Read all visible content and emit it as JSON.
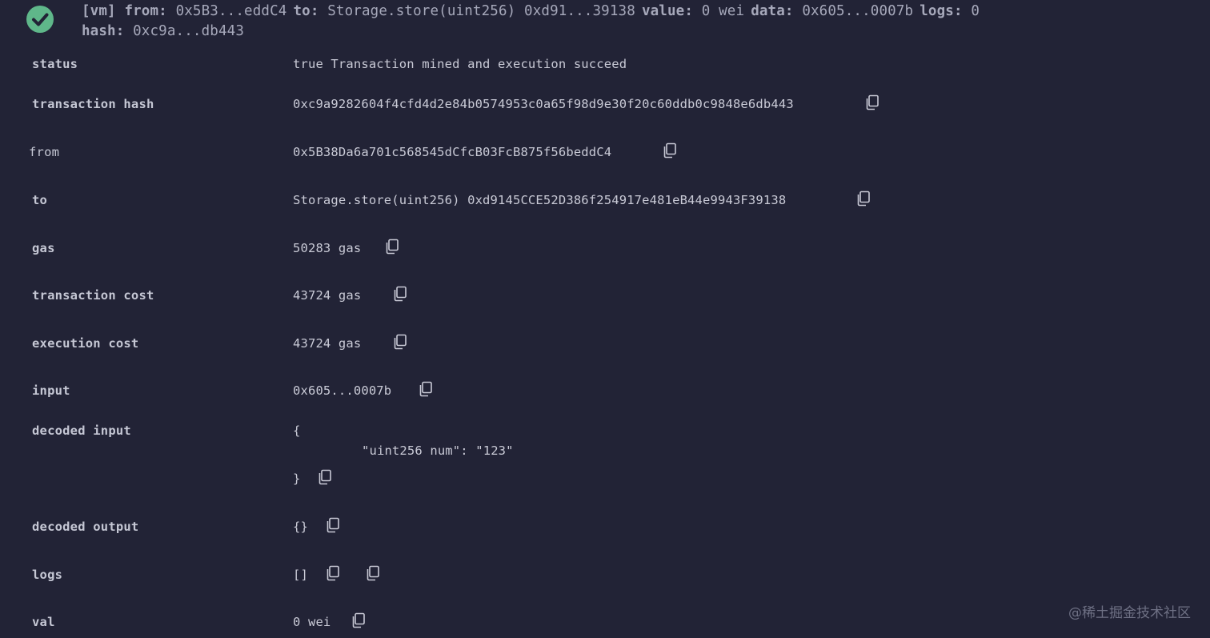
{
  "header": {
    "vm_tag": "[vm]",
    "from_label": "from:",
    "from_value": "0x5B3...eddC4",
    "to_label": "to:",
    "to_value": "Storage.store(uint256) 0xd91...39138",
    "value_label": "value:",
    "value_value": "0 wei",
    "data_label": "data:",
    "data_value": "0x605...0007b",
    "logs_label": "logs:",
    "logs_value": "0",
    "hash_label": "hash:",
    "hash_value": "0xc9a...db443",
    "status_icon": "check-circle-icon",
    "accent": "#5fb78a"
  },
  "rows": {
    "status": {
      "label": "status",
      "value": "true Transaction mined and execution succeed"
    },
    "transaction_hash": {
      "label": "transaction hash",
      "value": "0xc9a9282604f4cfd4d2e84b0574953c0a65f98d9e30f20c60ddb0c9848e6db443"
    },
    "from": {
      "label": "from",
      "value": "0x5B38Da6a701c568545dCfcB03FcB875f56beddC4"
    },
    "to": {
      "label": "to",
      "value": "Storage.store(uint256) 0xd9145CCE52D386f254917e481eB44e9943F39138"
    },
    "gas": {
      "label": "gas",
      "value": "50283 gas"
    },
    "transaction_cost": {
      "label": "transaction cost",
      "value": "43724 gas"
    },
    "execution_cost": {
      "label": "execution cost",
      "value": "43724 gas"
    },
    "input": {
      "label": "input",
      "value": "0x605...0007b"
    },
    "decoded_input": {
      "label": "decoded input",
      "open": "{",
      "body": "\"uint256 num\": \"123\"",
      "close": "}"
    },
    "decoded_output": {
      "label": "decoded output",
      "value": "{}"
    },
    "logs": {
      "label": "logs",
      "value": "[]"
    },
    "val": {
      "label": "val",
      "value": "0 wei"
    }
  },
  "watermark": "@稀土掘金技术社区"
}
